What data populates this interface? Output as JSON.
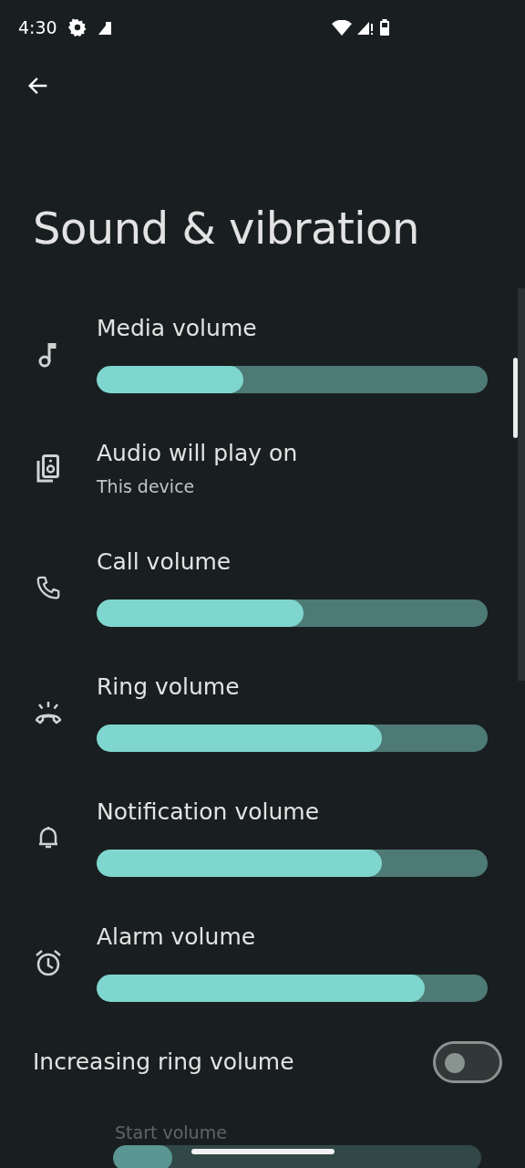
{
  "status_bar": {
    "time": "4:30"
  },
  "title": "Sound & vibration",
  "items": [
    {
      "kind": "slider",
      "title": "Media volume",
      "level": 0.375
    },
    {
      "kind": "info",
      "title": "Audio will play on",
      "subtitle": "This device"
    },
    {
      "kind": "slider",
      "title": "Call volume",
      "level": 0.53
    },
    {
      "kind": "slider",
      "title": "Ring volume",
      "level": 0.73
    },
    {
      "kind": "slider",
      "title": "Notification volume",
      "level": 0.73
    },
    {
      "kind": "slider",
      "title": "Alarm volume",
      "level": 0.84
    },
    {
      "kind": "toggle",
      "title": "Increasing ring volume",
      "on": false
    },
    {
      "kind": "subslider",
      "title": "Start volume",
      "level": 0.16,
      "disabled": true
    }
  ]
}
